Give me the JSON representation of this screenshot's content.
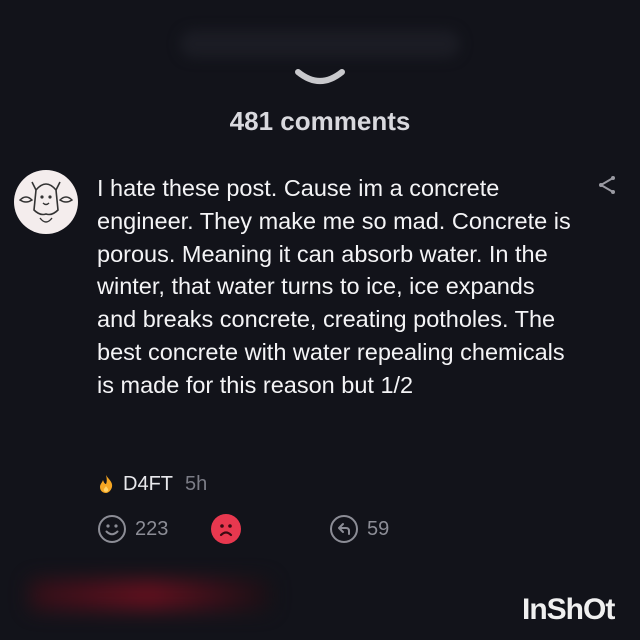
{
  "header": {
    "comments_count": "481 comments"
  },
  "comment": {
    "body": "I hate these post. Cause im a concrete engineer. They make me so mad. Concrete is porous. Meaning it can absorb water. In the winter, that water turns to ice, ice expands and breaks concrete, creating potholes. The best concrete with water repealing chemicals is made for this reason but 1/2",
    "author": "D4FT",
    "time": "5h",
    "upvotes": "223",
    "replies": "59"
  },
  "watermark": "InShOt",
  "colors": {
    "background": "#12131a",
    "downvote": "#e8384f",
    "flame": "#f5a623"
  }
}
